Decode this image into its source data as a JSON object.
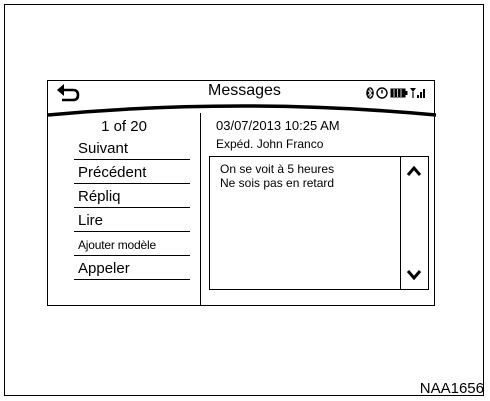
{
  "header": {
    "title": "Messages",
    "icons": [
      "back-arrow-icon",
      "bluetooth-icon",
      "clock-icon",
      "battery-icon",
      "signal-icon"
    ]
  },
  "left": {
    "counter": "1 of 20",
    "items": [
      "Suivant",
      "Précédent",
      "Répliq",
      "Lire",
      "Ajouter modèle",
      "Appeler"
    ]
  },
  "message": {
    "date": "03/07/2013 10:25 AM",
    "from": "Expéd.  John Franco",
    "lines": [
      "On se voit à 5 heures",
      "Ne sois pas en retard"
    ]
  },
  "footer": {
    "code": "NAA1656"
  }
}
